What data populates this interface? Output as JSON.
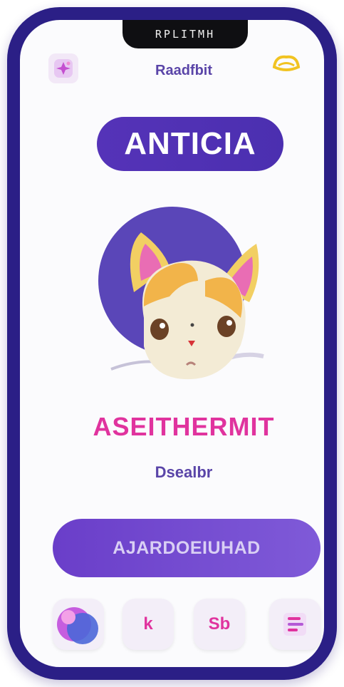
{
  "status_bar": {
    "text": "RPLITMH"
  },
  "header": {
    "title": "Raadfbit"
  },
  "brand": {
    "label": "ANTICIA"
  },
  "pet": {
    "name": "ASEITHERMIT",
    "subtitle": "Dsealbr"
  },
  "action": {
    "label": "AJARDOEIUHAD"
  },
  "tabs": [
    {
      "name": "home",
      "icon": "blob-icon"
    },
    {
      "name": "k",
      "label": "k"
    },
    {
      "name": "chat",
      "label": "Sb"
    },
    {
      "name": "menu",
      "icon": "list-icon"
    }
  ],
  "colors": {
    "frame": "#2b1f86",
    "brand": "#5533b8",
    "accent": "#e0339e",
    "button": "#6a3ec9"
  },
  "icons": {
    "top_left": "sparkle-icon",
    "top_right": "crown-icon",
    "pet_avatar": "cat-face-icon"
  }
}
